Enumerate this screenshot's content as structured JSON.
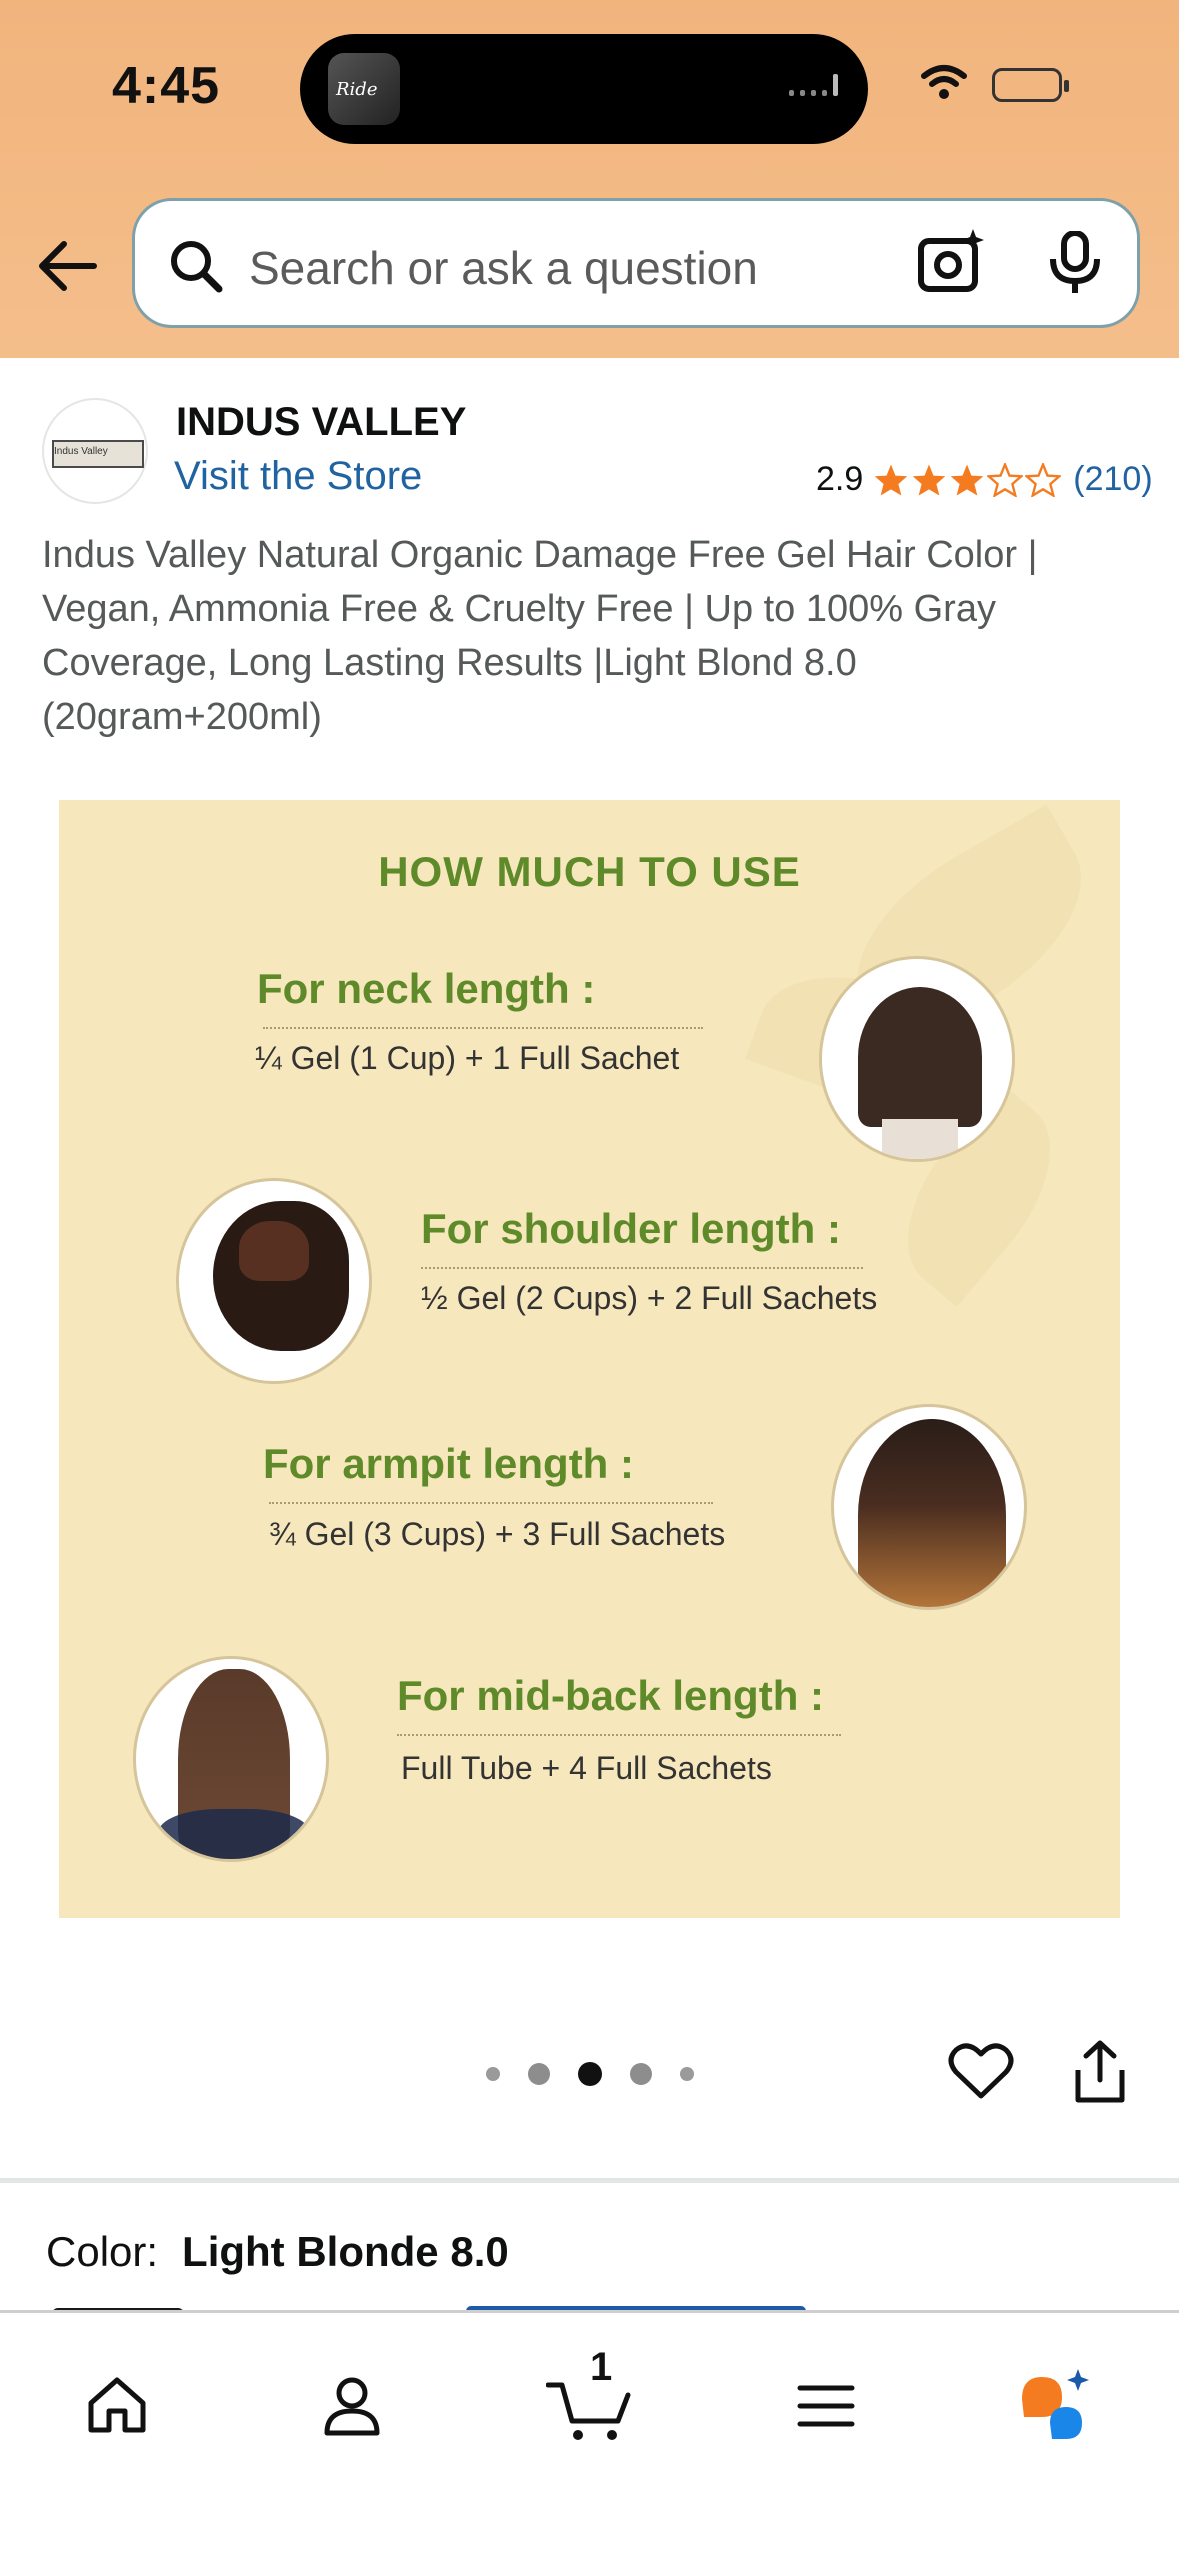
{
  "status_bar": {
    "time": "4:45"
  },
  "header": {
    "search_placeholder": "Search or ask a question"
  },
  "product": {
    "brand": "INDUS VALLEY",
    "brand_logo_text": "Indus Valley",
    "visit_store": "Visit the Store",
    "rating": "2.9",
    "rating_stars": 2.9,
    "rating_count": "(210)",
    "title": "Indus Valley Natural Organic Damage Free Gel Hair Color | Vegan, Ammonia Free & Cruelty Free | Up to 100% Gray Coverage, Long Lasting Results |Light Blond 8.0 (20gram+200ml)"
  },
  "hero": {
    "heading": "HOW MUCH TO USE",
    "items": [
      {
        "label": "For neck length :",
        "desc": "¼ Gel (1 Cup) + 1 Full Sachet"
      },
      {
        "label": "For shoulder length :",
        "desc": "½ Gel (2 Cups) + 2 Full Sachets"
      },
      {
        "label": "For armpit length :",
        "desc": "¾ Gel (3 Cups) + 3 Full Sachets"
      },
      {
        "label": "For mid-back length :",
        "desc": "Full Tube + 4 Full Sachets"
      }
    ]
  },
  "carousel": {
    "active_index": 2,
    "total": 5
  },
  "color": {
    "label": "Color:",
    "value": "Light Blonde 8.0"
  },
  "tabbar": {
    "cart_count": "1",
    "tabs": [
      "home-icon",
      "account-icon",
      "cart-icon",
      "menu-icon",
      "rufus-icon"
    ]
  },
  "colors": {
    "header_bg": "#f2b47d",
    "link": "#2162a1",
    "star": "#f47b20",
    "hero_bg": "#f6e7bd",
    "hero_green": "#5e8a2a"
  }
}
